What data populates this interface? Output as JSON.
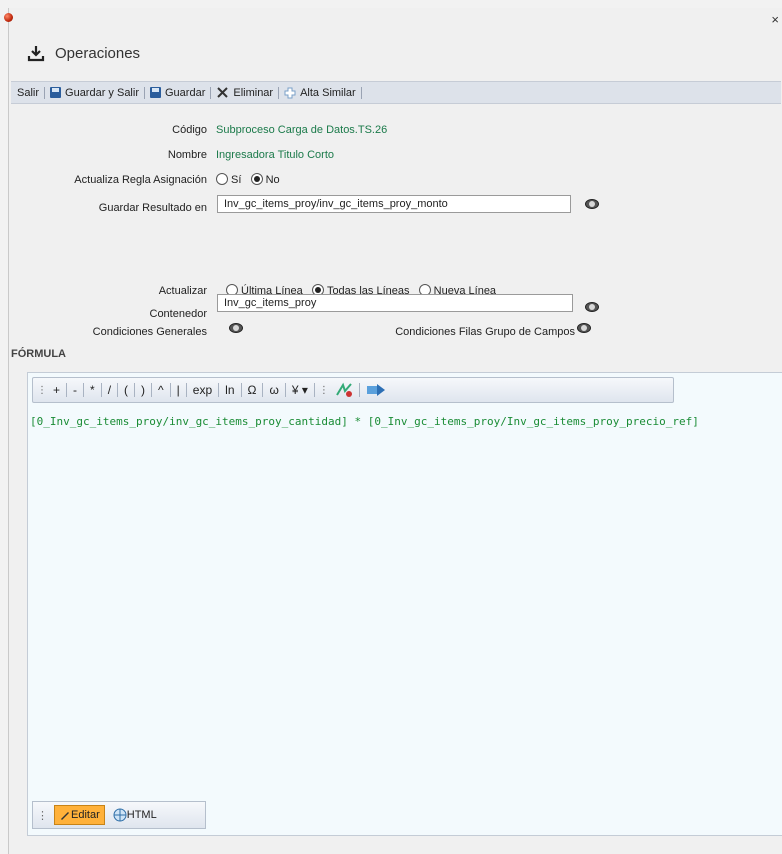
{
  "window": {
    "title": "Operaciones",
    "close_glyph": "×"
  },
  "toolbar": {
    "exit": "Salir",
    "save_exit": "Guardar y Salir",
    "save": "Guardar",
    "delete": "Eliminar",
    "add_similar": "Alta Similar"
  },
  "form": {
    "codigo_label": "Código",
    "codigo_value": "Subproceso Carga de Datos.TS.26",
    "nombre_label": "Nombre",
    "nombre_value": "Ingresadora Titulo Corto",
    "actualiza_label": "Actualiza Regla Asignación",
    "si": "Sí",
    "no": "No",
    "guardar_label": "Guardar Resultado en",
    "guardar_value": "Inv_gc_items_proy/inv_gc_items_proy_monto",
    "actualizar_label": "Actualizar",
    "ultima": "Última Línea",
    "todas": "Todas las Líneas",
    "nueva": "Nueva Línea",
    "contenedor_label": "Contenedor",
    "contenedor_value": "Inv_gc_items_proy",
    "cond_gen_label": "Condiciones Generales",
    "cond_filas_label": "Condiciones Filas Grupo de Campos"
  },
  "formula": {
    "section_title": "FÓRMULA",
    "ops": [
      "+",
      "-",
      "*",
      "/",
      "(",
      ")",
      "^",
      "|",
      "exp",
      "ln",
      "Ω",
      "ω",
      "¥"
    ],
    "text": "[0_Inv_gc_items_proy/inv_gc_items_proy_cantidad] * [0_Inv_gc_items_proy/Inv_gc_items_proy_precio_ref]",
    "tab_edit": "Editar",
    "tab_html": "HTML"
  }
}
